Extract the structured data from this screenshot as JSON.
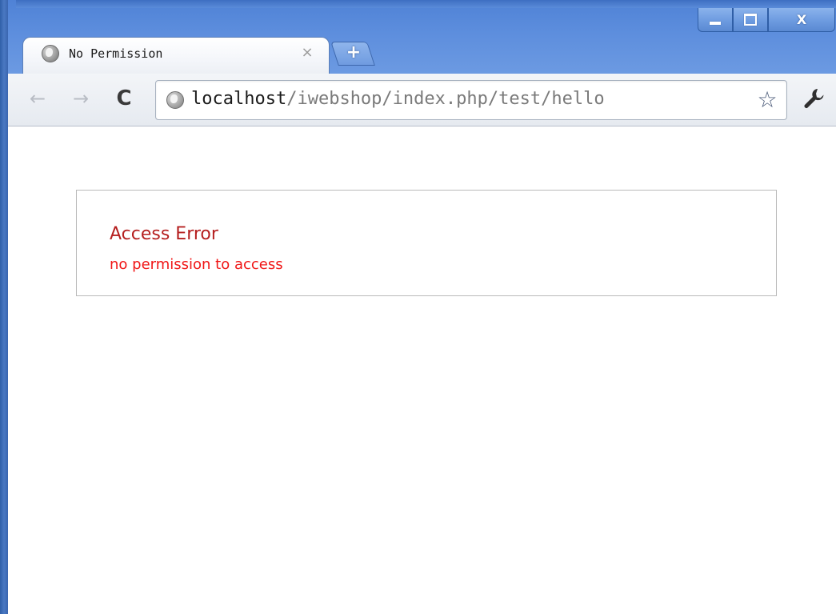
{
  "window": {
    "controls": {
      "minimize_glyph": "–",
      "maximize_glyph": "□",
      "close_glyph": "X"
    }
  },
  "tab": {
    "title": "No Permission",
    "close_glyph": "×",
    "favicon": "globe-icon"
  },
  "new_tab": {
    "glyph": "+"
  },
  "toolbar": {
    "back_glyph": "←",
    "forward_glyph": "→",
    "reload_glyph": "C",
    "star_glyph": "☆",
    "wrench_icon": "wrench-icon"
  },
  "address_bar": {
    "host": "localhost",
    "path": "/iwebshop/index.php/test/hello",
    "icon": "globe-icon"
  },
  "page": {
    "error_title": "Access Error",
    "error_message": "no permission to access"
  },
  "colors": {
    "titlebar": "#5d8edd",
    "error_title": "#b51f1f",
    "error_message": "#f01616",
    "error_border": "#b9b9b9"
  }
}
